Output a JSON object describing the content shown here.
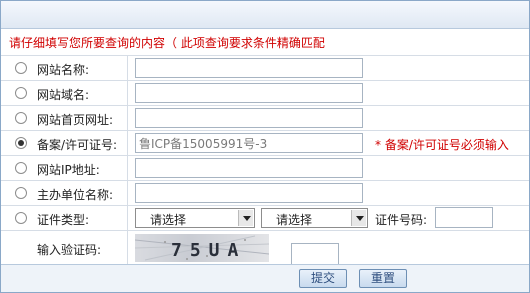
{
  "hint": "请仔细填写您所要查询的内容（ 此项查询要求条件精确匹配",
  "fields": [
    {
      "label": "网站名称:",
      "value": "",
      "selected": false
    },
    {
      "label": "网站域名:",
      "value": "",
      "selected": false
    },
    {
      "label": "网站首页网址:",
      "value": "",
      "selected": false
    },
    {
      "label": "备案/许可证号:",
      "value": "鲁ICP备15005991号-3",
      "selected": true,
      "note": "* 备案/许可证号必须输入"
    },
    {
      "label": "网站IP地址:",
      "value": "",
      "selected": false
    },
    {
      "label": "主办单位名称:",
      "value": "",
      "selected": false
    }
  ],
  "cert": {
    "label": "证件类型:",
    "select1": "请选择",
    "select2": "请选择",
    "number_label": "证件号码:",
    "number_value": ""
  },
  "captcha": {
    "label": "输入验证码:",
    "image_text": "75UA",
    "value": ""
  },
  "buttons": {
    "submit": "提交",
    "reset": "重置"
  },
  "colors": {
    "hint": "#d00000",
    "border": "#8aa8c8",
    "button_text": "#2f4f7f"
  }
}
